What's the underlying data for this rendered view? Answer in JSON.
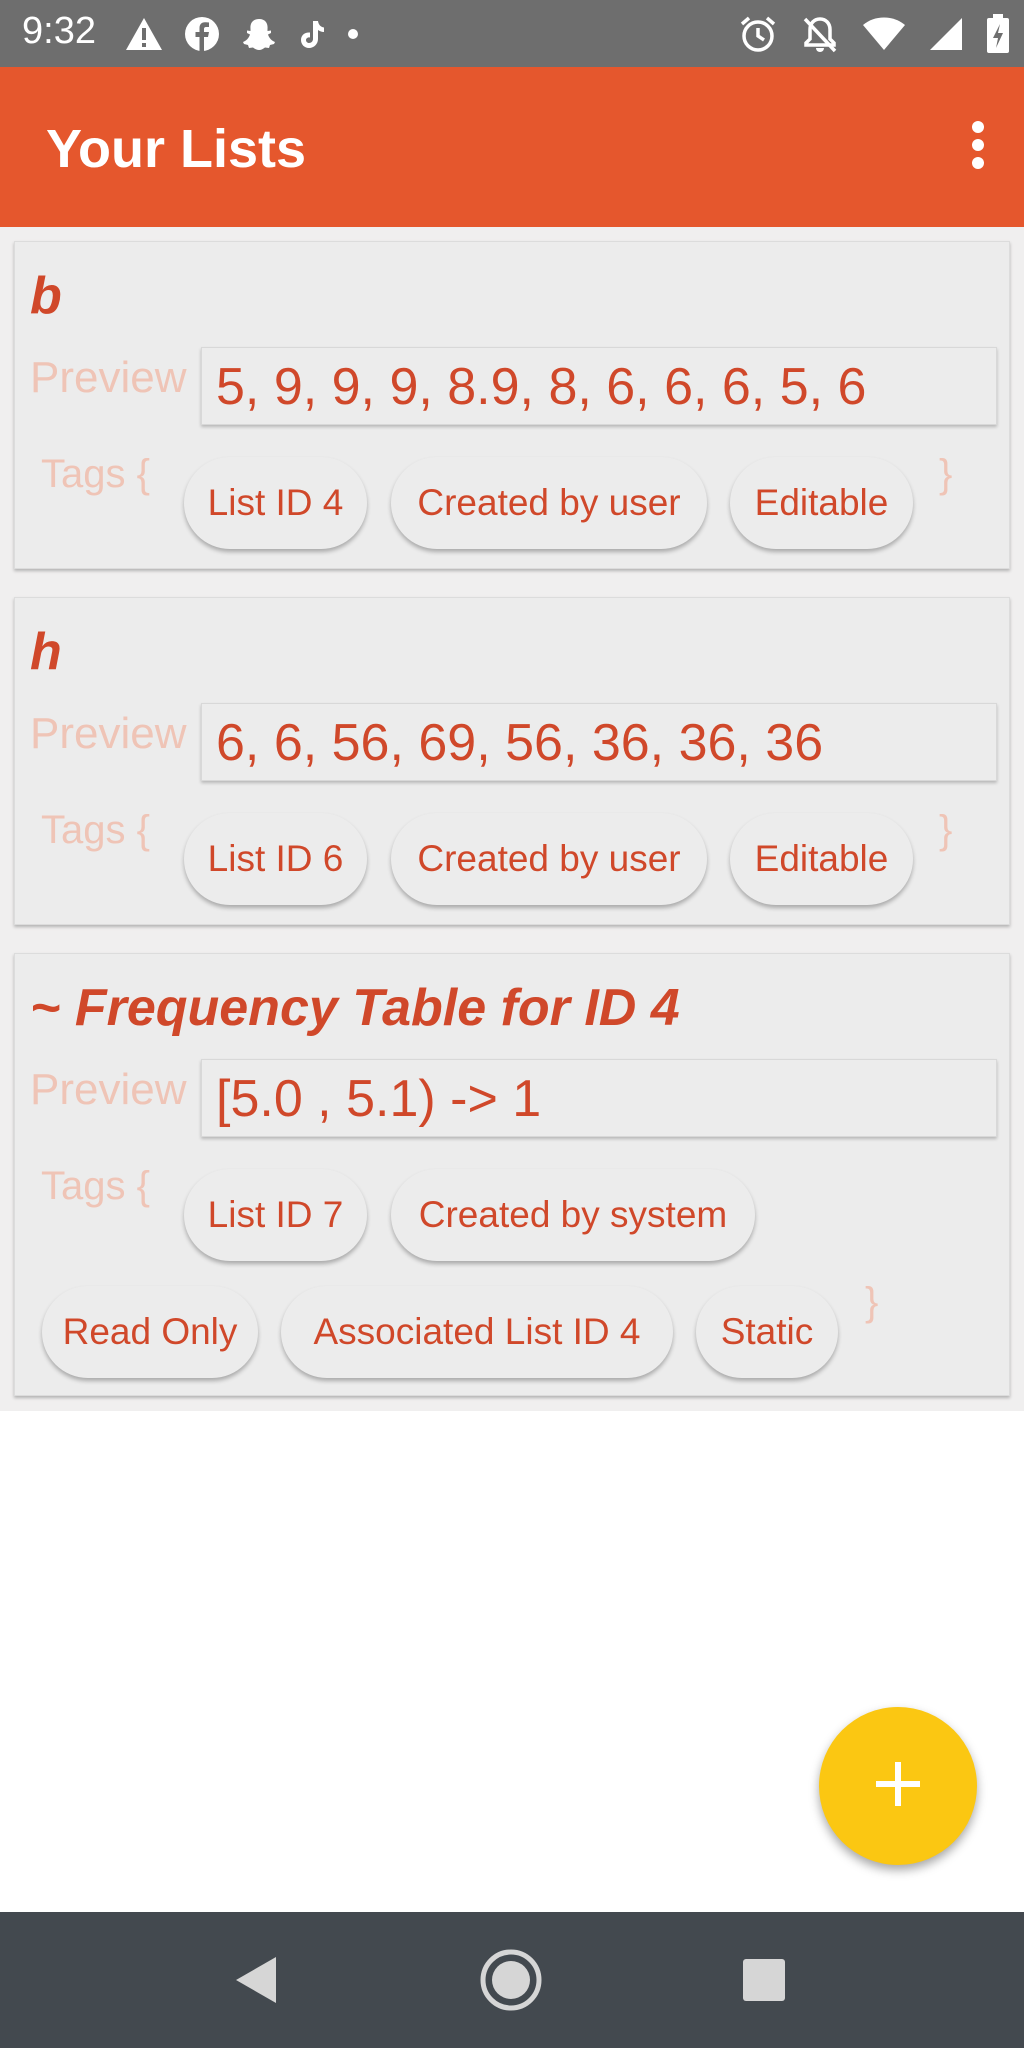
{
  "status_bar": {
    "time": "9:32",
    "left_icons": [
      "warning-icon",
      "facebook-icon",
      "snapchat-icon",
      "tiktok-icon",
      "dot-icon"
    ],
    "right_icons": [
      "alarm-icon",
      "notifications-off-icon",
      "wifi-icon",
      "signal-icon",
      "battery-charging-icon"
    ]
  },
  "app_bar": {
    "title": "Your Lists",
    "overflow_icon": "more-vert-icon",
    "color": "#e5572d"
  },
  "lists": [
    {
      "title": "b",
      "preview_label": "Preview",
      "preview": "5, 9, 9, 9, 8.9, 8, 6, 6, 6, 5, 6",
      "tags_label": "Tags {",
      "tags_close": "}",
      "tags": [
        "List ID 4",
        "Created by user",
        "Editable"
      ]
    },
    {
      "title": "h",
      "preview_label": "Preview",
      "preview": "6, 6, 56, 69, 56, 36, 36, 36",
      "tags_label": "Tags {",
      "tags_close": "}",
      "tags": [
        "List ID 6",
        "Created by user",
        "Editable"
      ]
    },
    {
      "title": "~ Frequency Table for ID 4",
      "preview_label": "Preview",
      "preview": "[5.0 , 5.1) -> 1",
      "tags_label": "Tags {",
      "tags_close": "}",
      "tags": [
        "List ID 7",
        "Created by system",
        "Read Only",
        "Associated List ID 4",
        "Static"
      ]
    }
  ],
  "fab": {
    "icon": "plus-icon",
    "color": "#fbc712"
  },
  "nav_bar": {
    "icons": [
      "back-icon",
      "home-icon",
      "recents-icon"
    ]
  },
  "colors": {
    "accent": "#d0482a",
    "muted_label": "#efc4b6",
    "card": "#ececec"
  }
}
